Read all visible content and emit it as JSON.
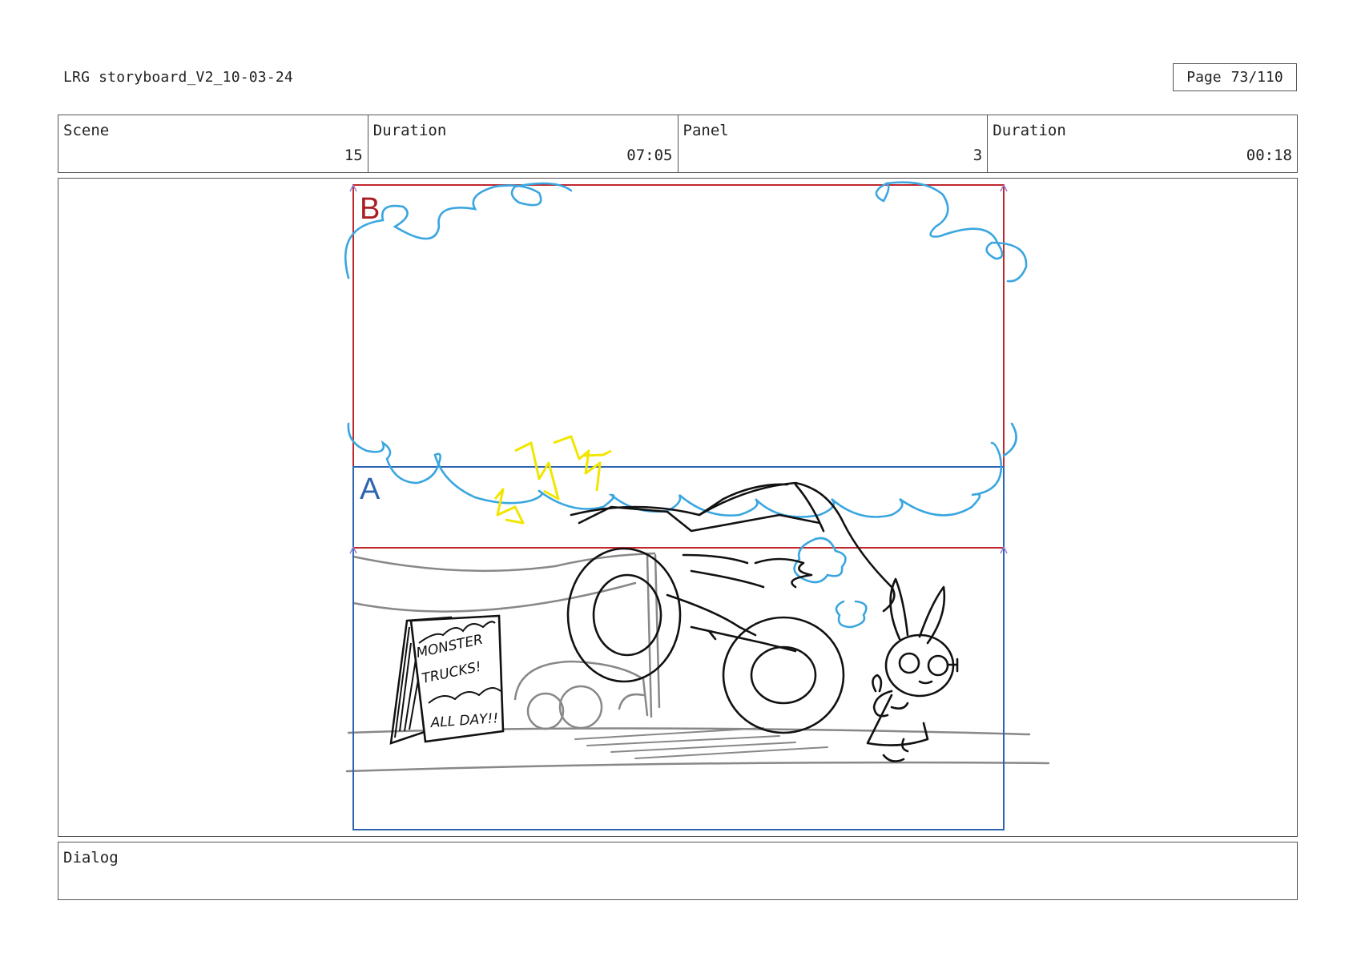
{
  "header": {
    "doc_title": "LRG storyboard_V2_10-03-24",
    "page_label": "Page",
    "page_value": "73/110"
  },
  "info": {
    "scene_label": "Scene",
    "scene_value": "15",
    "scene_duration_label": "Duration",
    "scene_duration_value": "07:05",
    "panel_label": "Panel",
    "panel_value": "3",
    "panel_duration_label": "Duration",
    "panel_duration_value": "00:18"
  },
  "frame": {
    "frame_b_label": "B",
    "frame_a_label": "A",
    "sign_lines": [
      "MONSTER",
      "TRUCKS!",
      "ALL DAY!!"
    ],
    "colors": {
      "frame_b": "#c0282d",
      "frame_a": "#2e63b0",
      "cloud": "#3aa6e0",
      "spark": "#f2e600",
      "ink": "#111111",
      "background_ink": "#888888"
    }
  },
  "dialog": {
    "label": "Dialog",
    "text": ""
  }
}
